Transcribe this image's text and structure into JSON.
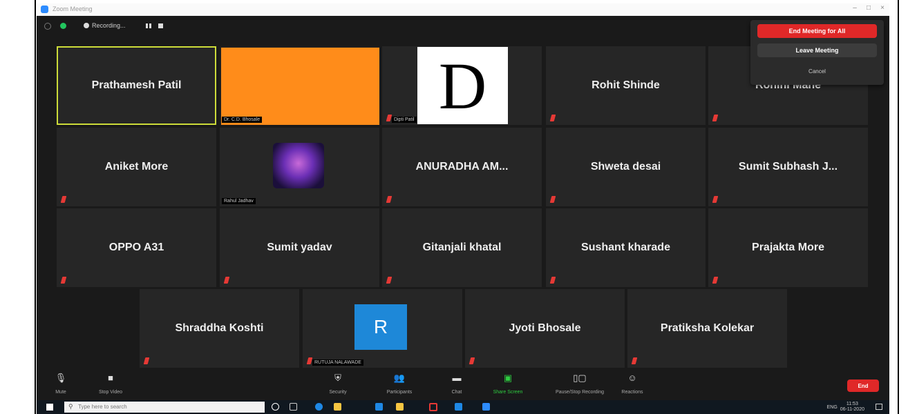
{
  "window": {
    "title": "Zoom Meeting",
    "controls": [
      "–",
      "□",
      "×"
    ]
  },
  "topbar": {
    "recording_label": "Recording..."
  },
  "participants": [
    {
      "name": "Prathamesh Patil",
      "tag": "",
      "highlighted": true
    },
    {
      "name": "",
      "tag": "Dr. C.D. Bhosale"
    },
    {
      "name": "",
      "tag": "Dipti Patil",
      "avatar_letter": "D"
    },
    {
      "name": "Rohit Shinde",
      "tag": ""
    },
    {
      "name": "Rohini Mane",
      "tag": ""
    },
    {
      "name": "Aniket More",
      "tag": ""
    },
    {
      "name": "",
      "tag": "Rahul Jadhav"
    },
    {
      "name": "ANURADHA AM...",
      "tag": ""
    },
    {
      "name": "Shweta desai",
      "tag": ""
    },
    {
      "name": "Sumit Subhash J...",
      "tag": ""
    },
    {
      "name": "OPPO A31",
      "tag": ""
    },
    {
      "name": "Sumit yadav",
      "tag": ""
    },
    {
      "name": "Gitanjali khatal",
      "tag": ""
    },
    {
      "name": "Sushant kharade",
      "tag": ""
    },
    {
      "name": "Prajakta More",
      "tag": ""
    },
    {
      "name": "Shraddha Koshti",
      "tag": ""
    },
    {
      "name": "",
      "tag": "RUTUJA NALAWADE",
      "avatar_letter": "R"
    },
    {
      "name": "Jyoti Bhosale",
      "tag": ""
    },
    {
      "name": "Pratiksha Kolekar",
      "tag": ""
    }
  ],
  "end_menu": {
    "end_all": "End Meeting for All",
    "leave": "Leave Meeting",
    "cancel": "Cancel"
  },
  "controls": [
    {
      "label": "Mute",
      "icon": "microphone-icon"
    },
    {
      "label": "Stop Video",
      "icon": "video-camera-icon"
    },
    {
      "label": "Security",
      "icon": "shield-icon"
    },
    {
      "label": "Participants",
      "icon": "participants-icon"
    },
    {
      "label": "Chat",
      "icon": "chat-icon"
    },
    {
      "label": "Share Screen",
      "icon": "share-screen-icon"
    },
    {
      "label": "Pause/Stop Recording",
      "icon": "pause-stop-icon"
    },
    {
      "label": "Reactions",
      "icon": "reactions-icon"
    }
  ],
  "end_button": "End",
  "taskbar": {
    "search_placeholder": "Type here to search",
    "lang": "ENG",
    "time": "11:53",
    "date": "06-11-2020"
  },
  "colors": {
    "end_red": "#e02828",
    "share_green": "#2ecc40",
    "orange_tile": "#ff8c1a",
    "avatar_blue": "#1e88d8",
    "active_border": "#cddc39"
  }
}
